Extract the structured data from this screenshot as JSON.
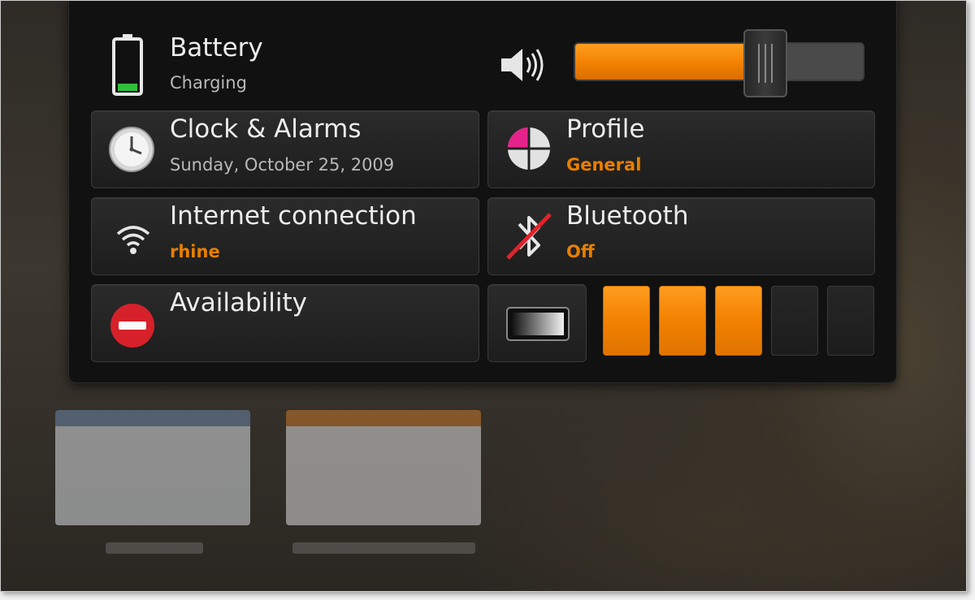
{
  "battery": {
    "title": "Battery",
    "status": "Charging",
    "icon": "battery-icon"
  },
  "volume": {
    "icon": "speaker-icon",
    "level": 0.6
  },
  "clock": {
    "title": "Clock & Alarms",
    "date": "Sunday, October 25, 2009",
    "icon": "clock-icon"
  },
  "profile": {
    "title": "Profile",
    "value": "General",
    "icon": "profile-icon"
  },
  "internet": {
    "title": "Internet connection",
    "network": "rhine",
    "icon": "wifi-icon"
  },
  "bluetooth": {
    "title": "Bluetooth",
    "state": "Off",
    "icon": "bluetooth-off-icon"
  },
  "availability": {
    "title": "Availability",
    "icon": "busy-icon"
  },
  "brightness": {
    "icon": "brightness-icon",
    "segments": [
      true,
      true,
      true,
      false,
      false
    ]
  },
  "colors": {
    "accent": "#f28100",
    "panel": "#111111",
    "tile": "#242424",
    "busy": "#d6212a",
    "text": "#ececec",
    "subtext": "#b9b9b9"
  }
}
